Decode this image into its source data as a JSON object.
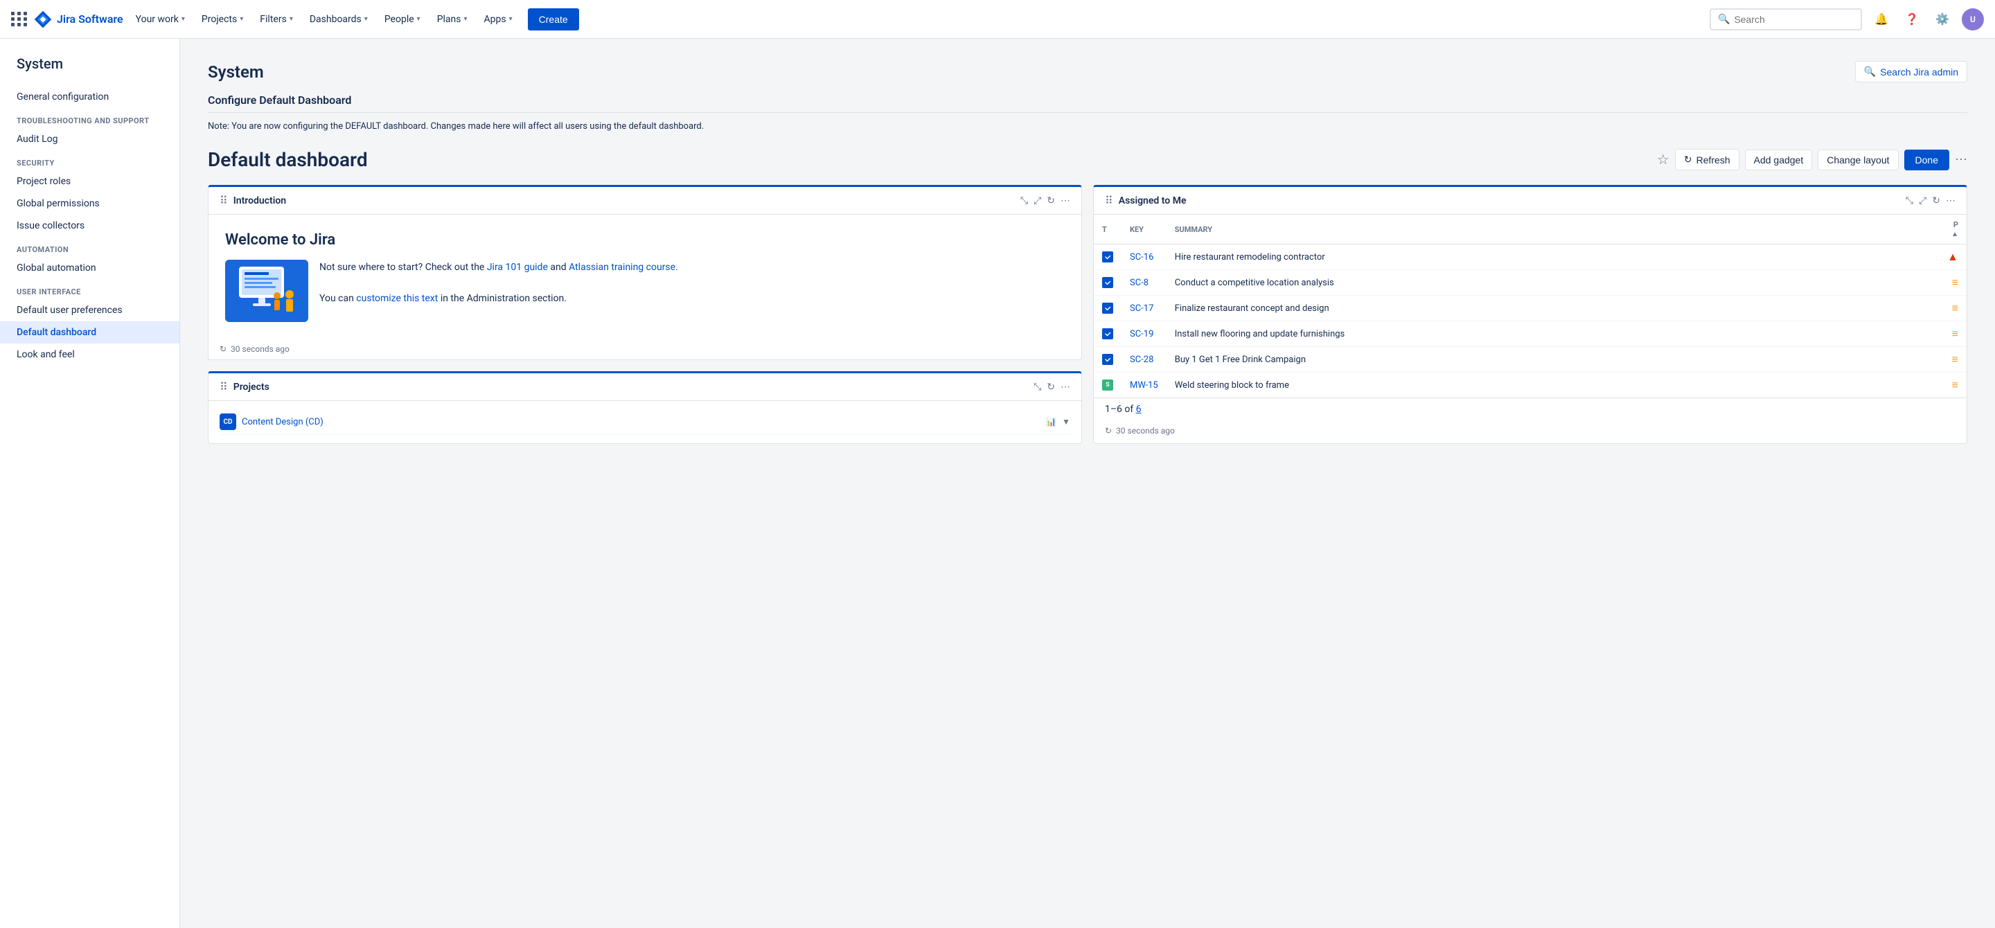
{
  "topnav": {
    "logo_text": "Jira Software",
    "nav_items": [
      {
        "label": "Your work",
        "has_chevron": true
      },
      {
        "label": "Projects",
        "has_chevron": true
      },
      {
        "label": "Filters",
        "has_chevron": true
      },
      {
        "label": "Dashboards",
        "has_chevron": true
      },
      {
        "label": "People",
        "has_chevron": true
      },
      {
        "label": "Plans",
        "has_chevron": true
      },
      {
        "label": "Apps",
        "has_chevron": true
      }
    ],
    "create_label": "Create",
    "search_placeholder": "Search"
  },
  "sidebar": {
    "title": "System",
    "items": [
      {
        "label": "General configuration",
        "section": null,
        "active": false
      },
      {
        "label": "Audit Log",
        "section": "TROUBLESHOOTING AND SUPPORT",
        "active": false
      },
      {
        "label": "Project roles",
        "section": "SECURITY",
        "active": false
      },
      {
        "label": "Global permissions",
        "section": null,
        "active": false
      },
      {
        "label": "Issue collectors",
        "section": null,
        "active": false
      },
      {
        "label": "Global automation",
        "section": "AUTOMATION",
        "active": false
      },
      {
        "label": "Default user preferences",
        "section": "USER INTERFACE",
        "active": false
      },
      {
        "label": "Default dashboard",
        "section": null,
        "active": true
      },
      {
        "label": "Look and feel",
        "section": null,
        "active": false
      }
    ]
  },
  "page": {
    "title": "System",
    "search_admin_label": "Search Jira admin",
    "section_title": "Configure Default Dashboard",
    "note": "Note: You are now configuring the DEFAULT dashboard. Changes made here will affect all users using the default dashboard."
  },
  "dashboard": {
    "title": "Default dashboard",
    "actions": {
      "refresh_label": "Refresh",
      "add_gadget_label": "Add gadget",
      "change_layout_label": "Change layout",
      "done_label": "Done"
    },
    "gadgets": [
      {
        "id": "introduction",
        "title": "Introduction",
        "welcome_heading": "Welcome to Jira",
        "intro_text_1": "Not sure where to start? Check out the ",
        "link1_text": "Jira 101 guide",
        "intro_text_2": " and ",
        "link2_text": "Atlassian training course",
        "intro_text_3": ".",
        "intro_text_4": "You can ",
        "link3_text": "customize this text",
        "intro_text_5": " in the Administration section.",
        "footer": "30 seconds ago"
      },
      {
        "id": "assigned-to-me",
        "title": "Assigned to Me",
        "columns": [
          "T",
          "Key",
          "Summary",
          "P"
        ],
        "rows": [
          {
            "type": "task",
            "key": "SC-16",
            "summary": "Hire restaurant remodeling contractor",
            "priority": "high"
          },
          {
            "type": "task",
            "key": "SC-8",
            "summary": "Conduct a competitive location analysis",
            "priority": "medium"
          },
          {
            "type": "task",
            "key": "SC-17",
            "summary": "Finalize restaurant concept and design",
            "priority": "medium"
          },
          {
            "type": "task",
            "key": "SC-19",
            "summary": "Install new flooring and update furnishings",
            "priority": "medium"
          },
          {
            "type": "task",
            "key": "SC-28",
            "summary": "Buy 1 Get 1 Free Drink Campaign",
            "priority": "medium"
          },
          {
            "type": "story",
            "key": "MW-15",
            "summary": "Weld steering block to frame",
            "priority": "medium"
          }
        ],
        "pagination": "1–6 of 6",
        "footer": "30 seconds ago"
      }
    ],
    "gadget_projects": {
      "title": "Projects",
      "items": [
        {
          "name": "Content Design (CD)",
          "icon": "CD"
        }
      ]
    }
  }
}
